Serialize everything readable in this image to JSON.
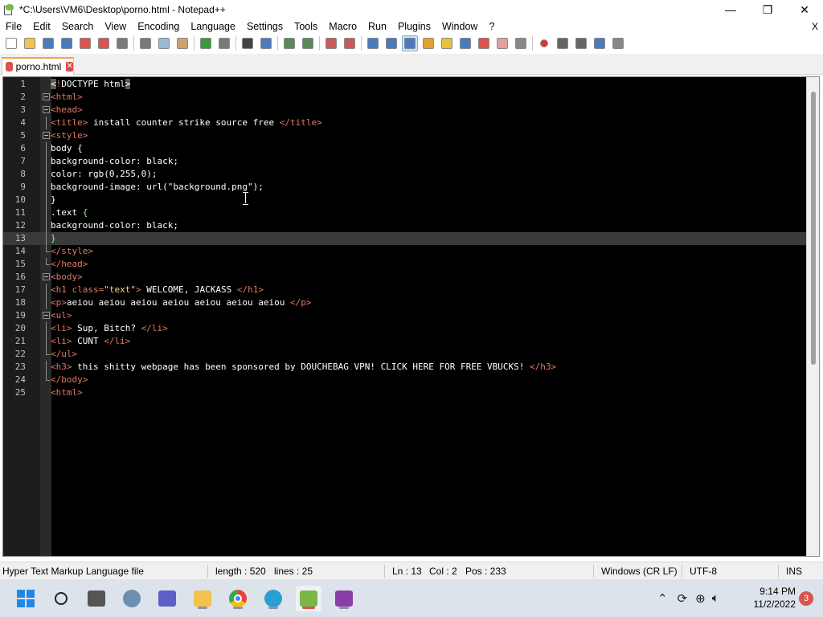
{
  "window": {
    "title": "*C:\\Users\\VM6\\Desktop\\porno.html - Notepad++",
    "controls": {
      "minimize": "—",
      "maximize": "❐",
      "close": "✕"
    }
  },
  "menu": {
    "items": [
      "File",
      "Edit",
      "Search",
      "View",
      "Encoding",
      "Language",
      "Settings",
      "Tools",
      "Macro",
      "Run",
      "Plugins",
      "Window",
      "?"
    ],
    "close_doc": "X"
  },
  "toolbar": {
    "buttons": [
      {
        "name": "new-file-icon",
        "color": "#ffffff"
      },
      {
        "name": "open-file-icon",
        "color": "#f2c14e"
      },
      {
        "name": "save-icon",
        "color": "#4a7bbf"
      },
      {
        "name": "save-all-icon",
        "color": "#4a7bbf"
      },
      {
        "name": "close-icon",
        "color": "#d9534f"
      },
      {
        "name": "close-all-icon",
        "color": "#d9534f"
      },
      {
        "name": "print-icon",
        "color": "#7a7a7a"
      },
      {
        "name": "cut-icon",
        "color": "#7a7a7a"
      },
      {
        "name": "copy-icon",
        "color": "#9ab8d8"
      },
      {
        "name": "paste-icon",
        "color": "#c8a46a"
      },
      {
        "name": "undo-icon",
        "color": "#3a9a3a"
      },
      {
        "name": "redo-icon",
        "color": "#7a7a7a"
      },
      {
        "name": "find-icon",
        "color": "#444444"
      },
      {
        "name": "replace-icon",
        "color": "#4a7bbf"
      },
      {
        "name": "zoom-in-icon",
        "color": "#5a8a5a"
      },
      {
        "name": "zoom-out-icon",
        "color": "#5a8a5a"
      },
      {
        "name": "sync-vertical-icon",
        "color": "#c85a5a"
      },
      {
        "name": "sync-horizontal-icon",
        "color": "#c85a5a"
      },
      {
        "name": "word-wrap-icon",
        "color": "#4a7bbf"
      },
      {
        "name": "show-all-chars-icon",
        "color": "#4a7bbf"
      },
      {
        "name": "indent-guide-icon",
        "color": "#4a7bbf"
      },
      {
        "name": "udl-icon",
        "color": "#e8a030"
      },
      {
        "name": "doc-map-icon",
        "color": "#e8c040"
      },
      {
        "name": "function-list-icon",
        "color": "#4a7bbf"
      },
      {
        "name": "folder-workspace-icon",
        "color": "#d9534f"
      },
      {
        "name": "doc-switcher-icon",
        "color": "#e0a0a0"
      },
      {
        "name": "monitoring-icon",
        "color": "#888888"
      },
      {
        "name": "record-macro-icon",
        "color": "#d9342f"
      },
      {
        "name": "stop-macro-icon",
        "color": "#666666"
      },
      {
        "name": "play-macro-icon",
        "color": "#666666"
      },
      {
        "name": "run-macro-multiple-icon",
        "color": "#4a7bbf"
      },
      {
        "name": "save-macro-icon",
        "color": "#888888"
      }
    ]
  },
  "tabs": [
    {
      "label": "porno.html",
      "modified": true
    }
  ],
  "editor": {
    "current_line": 13,
    "lines": [
      [
        {
          "t": "sel",
          "v": "<"
        },
        {
          "t": "tag",
          "v": "!"
        },
        {
          "t": "plain",
          "v": "DOCTYPE html"
        },
        {
          "t": "sel",
          "v": ">"
        }
      ],
      [
        {
          "t": "tag",
          "v": "<html>"
        }
      ],
      [
        {
          "t": "tag",
          "v": "<head>"
        }
      ],
      [
        {
          "t": "tag",
          "v": "<title>"
        },
        {
          "t": "plain",
          "v": " install counter strike source free "
        },
        {
          "t": "tag",
          "v": "</title>"
        }
      ],
      [
        {
          "t": "tag",
          "v": "<style>"
        }
      ],
      [
        {
          "t": "plain",
          "v": "body {"
        }
      ],
      [
        {
          "t": "plain",
          "v": "background-color: black;"
        }
      ],
      [
        {
          "t": "plain",
          "v": "color: rgb(0,255,0);"
        }
      ],
      [
        {
          "t": "plain",
          "v": "background-image: url(\"background.png\");"
        }
      ],
      [
        {
          "t": "plain",
          "v": "}"
        }
      ],
      [
        {
          "t": "plain",
          "v": ".text "
        },
        {
          "t": "brace",
          "v": "{"
        }
      ],
      [
        {
          "t": "plain",
          "v": "background-color: black;"
        }
      ],
      [
        {
          "t": "brace",
          "v": "}"
        }
      ],
      [
        {
          "t": "tag",
          "v": "</style>"
        }
      ],
      [
        {
          "t": "tag",
          "v": "</head>"
        }
      ],
      [
        {
          "t": "tag",
          "v": "<body>"
        }
      ],
      [
        {
          "t": "tag",
          "v": "<h1 "
        },
        {
          "t": "attr",
          "v": "class"
        },
        {
          "t": "tag",
          "v": "="
        },
        {
          "t": "val",
          "v": "\"text\""
        },
        {
          "t": "tag",
          "v": ">"
        },
        {
          "t": "plain",
          "v": " WELCOME, JACKASS "
        },
        {
          "t": "tag",
          "v": "</h1>"
        }
      ],
      [
        {
          "t": "tag",
          "v": "<p>"
        },
        {
          "t": "plain",
          "v": "aeiou aeiou aeiou aeiou aeiou aeiou aeiou "
        },
        {
          "t": "tag",
          "v": "</p>"
        }
      ],
      [
        {
          "t": "tag",
          "v": "<ul>"
        }
      ],
      [
        {
          "t": "tag",
          "v": "<li>"
        },
        {
          "t": "plain",
          "v": " Sup, Bitch? "
        },
        {
          "t": "tag",
          "v": "</li>"
        }
      ],
      [
        {
          "t": "tag",
          "v": "<li>"
        },
        {
          "t": "plain",
          "v": " CUNT "
        },
        {
          "t": "tag",
          "v": "</li>"
        }
      ],
      [
        {
          "t": "tag",
          "v": "</ul>"
        }
      ],
      [
        {
          "t": "tag",
          "v": "<h3>"
        },
        {
          "t": "plain",
          "v": " this shitty webpage has been sponsored by DOUCHEBAG VPN! CLICK HERE FOR FREE VBUCKS! "
        },
        {
          "t": "tag",
          "v": "</h3>"
        }
      ],
      [
        {
          "t": "tag",
          "v": "</body>"
        }
      ],
      [
        {
          "t": "tag",
          "v": "<html>"
        }
      ]
    ],
    "folds": {
      "2": "open",
      "3": "open",
      "5": "open",
      "16": "open",
      "19": "open"
    }
  },
  "status": {
    "language": "Hyper Text Markup Language file",
    "length": "length : 520",
    "lines": "lines : 25",
    "ln": "Ln : 13",
    "col": "Col : 2",
    "pos": "Pos : 233",
    "eol": "Windows (CR LF)",
    "encoding": "UTF-8",
    "mode": "INS"
  },
  "taskbar": {
    "apps": [
      {
        "name": "windows-start-icon",
        "color": "#1e88e5"
      },
      {
        "name": "search-icon",
        "color": "#222222"
      },
      {
        "name": "task-view-icon",
        "color": "#555555"
      },
      {
        "name": "widgets-icon",
        "color": "#6a8fb0"
      },
      {
        "name": "teams-chat-icon",
        "color": "#5b5fc7"
      },
      {
        "name": "file-explorer-icon",
        "color": "#f2c14e"
      },
      {
        "name": "chrome-icon",
        "color": "#34a853"
      },
      {
        "name": "globe-app-icon",
        "color": "#2a9fd6"
      },
      {
        "name": "notepadpp-icon",
        "color": "#7ab648"
      },
      {
        "name": "winrar-icon",
        "color": "#8a3fa8"
      }
    ],
    "time": "9:14 PM",
    "date": "11/2/2022",
    "notifications": "3"
  }
}
